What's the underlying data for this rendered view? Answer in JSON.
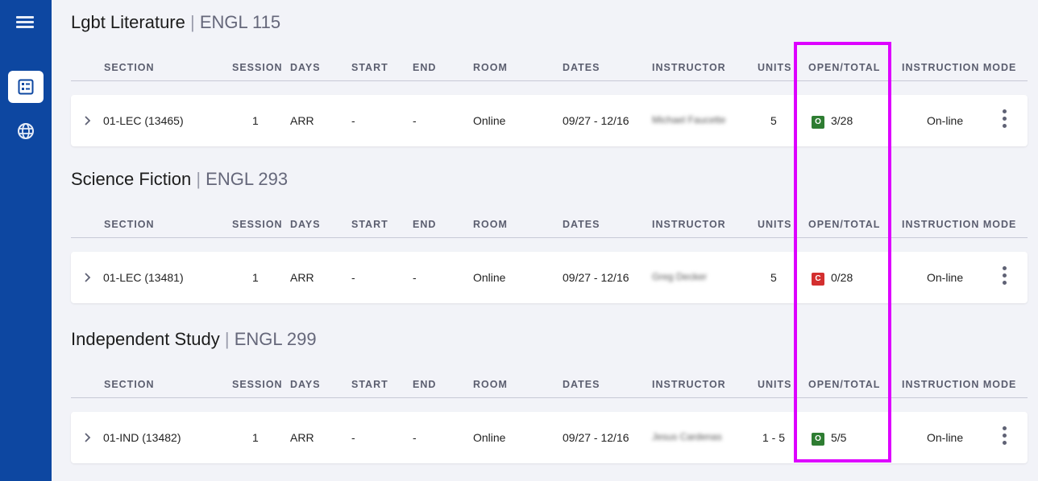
{
  "colors": {
    "sidebar": "#0d47a1",
    "open_badge": "#2e7d32",
    "closed_badge": "#d32f2f",
    "highlight": "#dd00ff"
  },
  "sidebar": {
    "menu_icon": "hamburger-menu-icon",
    "items": [
      {
        "icon": "schedule-list-icon",
        "active": true
      },
      {
        "icon": "globe-icon",
        "active": false
      }
    ]
  },
  "columns": {
    "section": "SECTION",
    "session": "SESSION",
    "days": "DAYS",
    "start": "START",
    "end": "END",
    "room": "ROOM",
    "dates": "DATES",
    "instructor": "INSTRUCTOR",
    "units": "UNITS",
    "open_total": "OPEN/TOTAL",
    "instruction_mode": "INSTRUCTION MODE"
  },
  "courses": [
    {
      "title": "Lgbt Literature",
      "separator": "|",
      "code": "ENGL 115",
      "row": {
        "section": "01-LEC (13465)",
        "session": "1",
        "days": "ARR",
        "start": "-",
        "end": "-",
        "room": "Online",
        "dates": "09/27 - 12/16",
        "instructor": "Michael Faucette",
        "units": "5",
        "status": "O",
        "status_kind": "open",
        "open_total": "3/28",
        "mode": "On-line"
      }
    },
    {
      "title": "Science Fiction",
      "separator": "|",
      "code": "ENGL 293",
      "row": {
        "section": "01-LEC (13481)",
        "session": "1",
        "days": "ARR",
        "start": "-",
        "end": "-",
        "room": "Online",
        "dates": "09/27 - 12/16",
        "instructor": "Greg Decker",
        "units": "5",
        "status": "C",
        "status_kind": "closed",
        "open_total": "0/28",
        "mode": "On-line"
      }
    },
    {
      "title": "Independent Study",
      "separator": "|",
      "code": "ENGL 299",
      "row": {
        "section": "01-IND (13482)",
        "session": "1",
        "days": "ARR",
        "start": "-",
        "end": "-",
        "room": "Online",
        "dates": "09/27 - 12/16",
        "instructor": "Jesus Cardenas",
        "units": "1 - 5",
        "status": "O",
        "status_kind": "open",
        "open_total": "5/5",
        "mode": "On-line"
      }
    }
  ]
}
